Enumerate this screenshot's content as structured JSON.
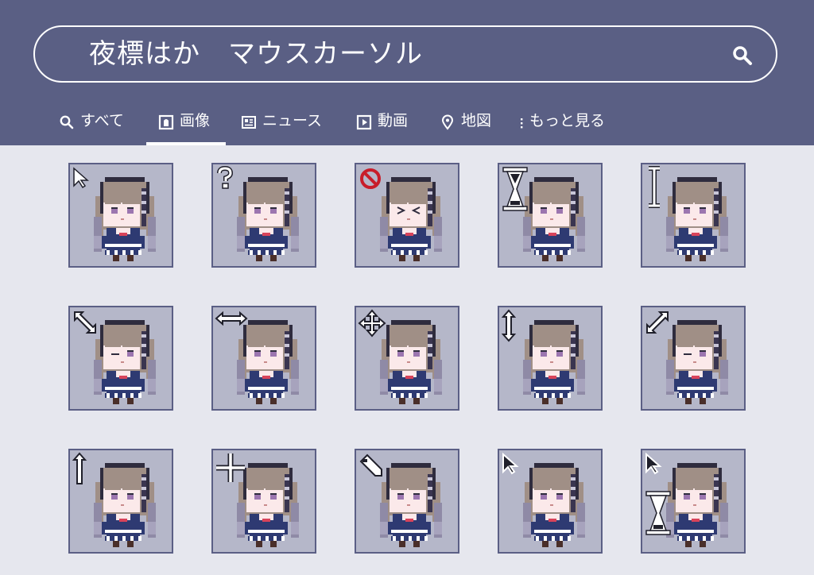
{
  "search": {
    "query": "夜標はか　マウスカーソル"
  },
  "tabs": [
    {
      "label": "すべて",
      "icon": "search-icon",
      "active": false
    },
    {
      "label": "画像",
      "icon": "image-icon",
      "active": true
    },
    {
      "label": "ニュース",
      "icon": "news-icon",
      "active": false
    },
    {
      "label": "動画",
      "icon": "video-icon",
      "active": false
    },
    {
      "label": "地図",
      "icon": "map-pin-icon",
      "active": false
    },
    {
      "label": "もっと見る",
      "icon": "more-dots-icon",
      "active": false
    }
  ],
  "colors": {
    "header_bg": "#5a5f84",
    "page_bg": "#e6e7ee",
    "tile_bg": "#b5b7c9",
    "tile_border": "#5b5f85",
    "hair": "#a08f86",
    "outline": "#2f2c3e",
    "uniform": "#2e3a72",
    "skin": "#fbe9ea",
    "eye": "#9c76b0"
  },
  "results": [
    {
      "cursor": "arrow-pointer-icon"
    },
    {
      "cursor": "help-question-icon"
    },
    {
      "cursor": "unavailable-icon"
    },
    {
      "cursor": "busy-hourglass-icon"
    },
    {
      "cursor": "text-beam-icon"
    },
    {
      "cursor": "resize-diagonal-nw-se-icon"
    },
    {
      "cursor": "resize-horizontal-icon"
    },
    {
      "cursor": "move-icon"
    },
    {
      "cursor": "resize-vertical-icon"
    },
    {
      "cursor": "resize-diagonal-ne-sw-icon"
    },
    {
      "cursor": "alternate-select-up-arrow-icon"
    },
    {
      "cursor": "precision-crosshair-icon"
    },
    {
      "cursor": "handwriting-pen-icon"
    },
    {
      "cursor": "arrow-pointer-dark-icon"
    },
    {
      "cursor": "working-in-background-icon"
    }
  ]
}
